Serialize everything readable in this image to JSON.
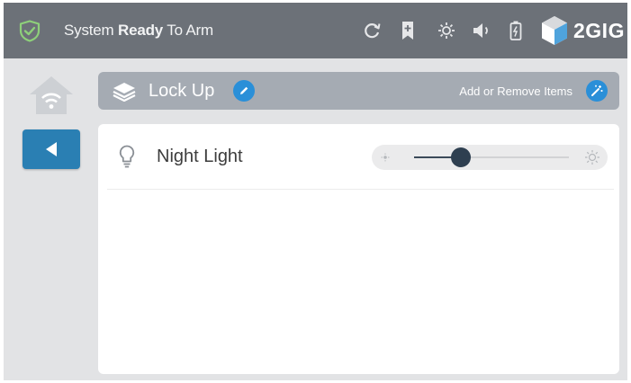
{
  "status_bar": {
    "status_prefix": "System ",
    "status_bold": "Ready",
    "status_suffix": " To Arm",
    "icons": [
      "shield-check-icon",
      "refresh-icon",
      "bookmark-icon",
      "brightness-icon",
      "volume-icon",
      "battery-icon"
    ],
    "brand": "2GIG"
  },
  "nav": {
    "home_icon": "home-wifi-icon",
    "back_icon": "back-arrow-icon"
  },
  "scene": {
    "title": "Lock Up",
    "action_label": "Add or Remove Items"
  },
  "items": [
    {
      "label": "Night Light",
      "icon": "lightbulb-icon",
      "level": 0.3
    }
  ],
  "colors": {
    "topbar": "#6c7178",
    "accent_blue": "#2a8fd8",
    "back_button": "#2a7fb3",
    "shield_green": "#8ed07a",
    "header": "#a5abb3"
  }
}
